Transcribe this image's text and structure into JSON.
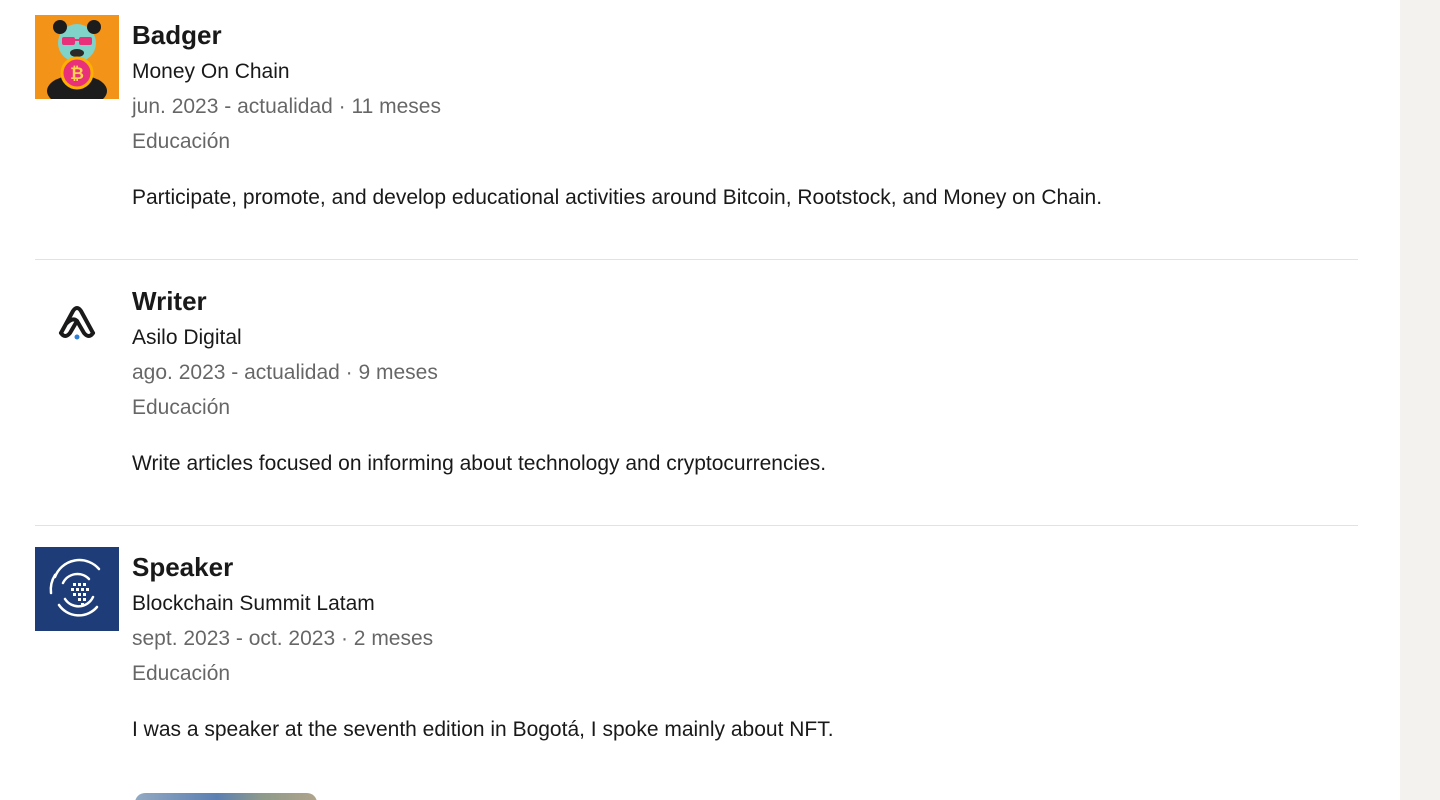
{
  "experience": [
    {
      "role": "Badger",
      "company": "Money On Chain",
      "dates": "jun. 2023 - actualidad · 11 meses",
      "category": "Educación",
      "description": "Participate, promote, and develop educational activities around Bitcoin, Rootstock, and Money on Chain.",
      "logo_icon": "panda-coin-icon"
    },
    {
      "role": "Writer",
      "company": "Asilo Digital",
      "dates": "ago. 2023 - actualidad · 9 meses",
      "category": "Educación",
      "description": "Write articles focused on informing about technology and cryptocurrencies.",
      "logo_icon": "asilo-digital-icon"
    },
    {
      "role": "Speaker",
      "company": "Blockchain Summit Latam",
      "dates": "sept. 2023 - oct. 2023 · 2 meses",
      "category": "Educación",
      "description": "I was a speaker at the seventh edition in Bogotá, I spoke mainly about NFT.",
      "logo_icon": "blockchain-summit-globe-icon"
    }
  ],
  "colors": {
    "money_on_chain_bg": "#f39317",
    "blockchain_summit_bg": "#1e3c78",
    "right_rail_bg": "#f3f2ef"
  }
}
